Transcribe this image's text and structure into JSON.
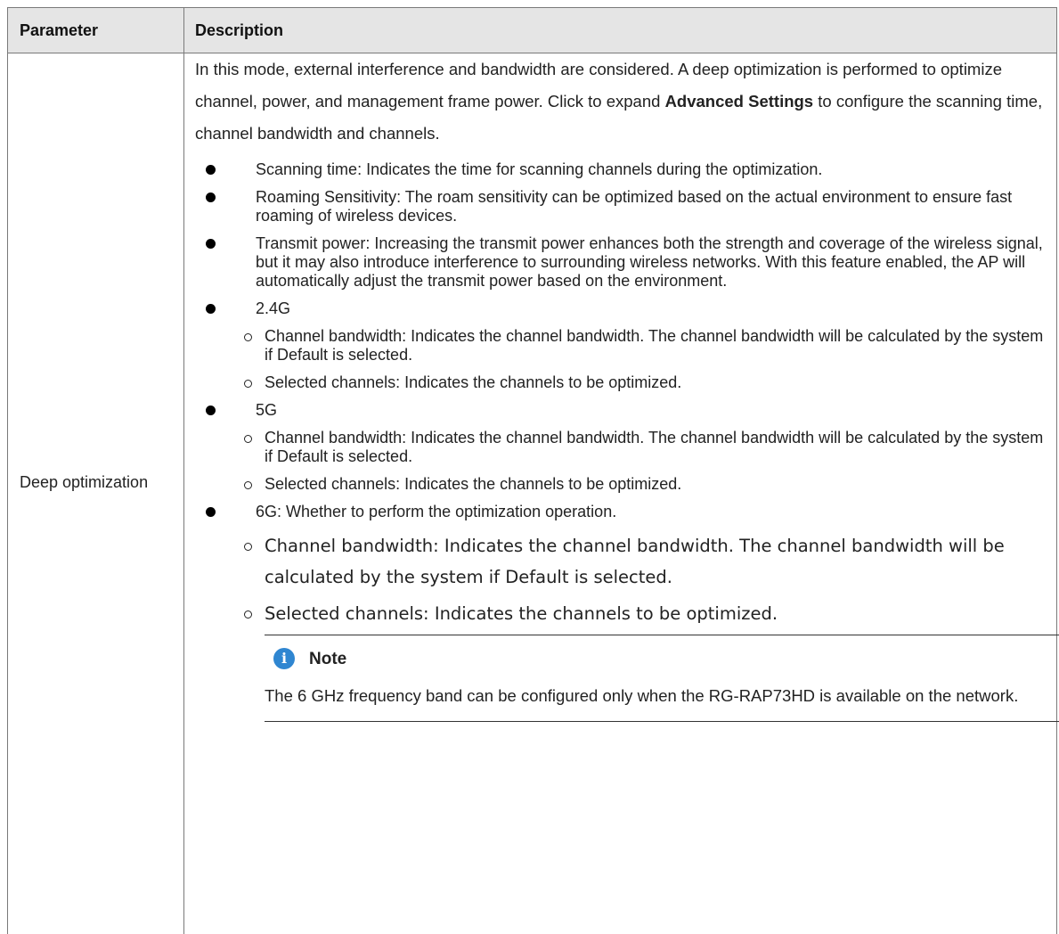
{
  "table": {
    "headers": [
      "Parameter",
      "Description"
    ],
    "param_name": "Deep optimization",
    "intro": {
      "before": "In this mode, external interference and bandwidth are considered. A deep optimization is performed to optimize channel, power, and management frame power. Click to expand ",
      "bold": "Advanced Settings",
      "after": " to configure the scanning time, channel bandwidth and channels."
    },
    "items": [
      "Scanning time: Indicates the time for scanning channels during the optimization.",
      "Roaming Sensitivity: The roam sensitivity can be optimized based on the actual environment to ensure fast roaming of wireless devices.",
      "Transmit power: Increasing the transmit power enhances both the strength and coverage of the wireless signal, but it may also introduce interference to surrounding wireless networks. With this feature enabled, the AP will automatically adjust the transmit power based on the environment."
    ],
    "band_24": {
      "label": "2.4G",
      "sub": [
        "Channel bandwidth: Indicates the channel bandwidth. The channel bandwidth will be calculated by the system if Default is selected.",
        "Selected channels: Indicates the channels to be optimized."
      ]
    },
    "band_5": {
      "label": "5G",
      "sub": [
        "Channel bandwidth: Indicates the channel bandwidth. The channel bandwidth will be calculated by the system if Default is selected.",
        "Selected channels: Indicates the channels to be optimized."
      ]
    },
    "band_6": {
      "label": "6G: Whether to perform the optimization operation.",
      "sub": [
        "Channel bandwidth: Indicates the channel bandwidth. The channel bandwidth will be calculated by the system if Default is selected.",
        "Selected channels: Indicates the channels to be optimized."
      ]
    },
    "note": {
      "icon": "info-icon",
      "icon_glyph": "i",
      "icon_color": "#2f86d1",
      "title": "Note",
      "text": "The 6 GHz frequency band can be configured only when the RG-RAP73HD is available on the network."
    }
  }
}
